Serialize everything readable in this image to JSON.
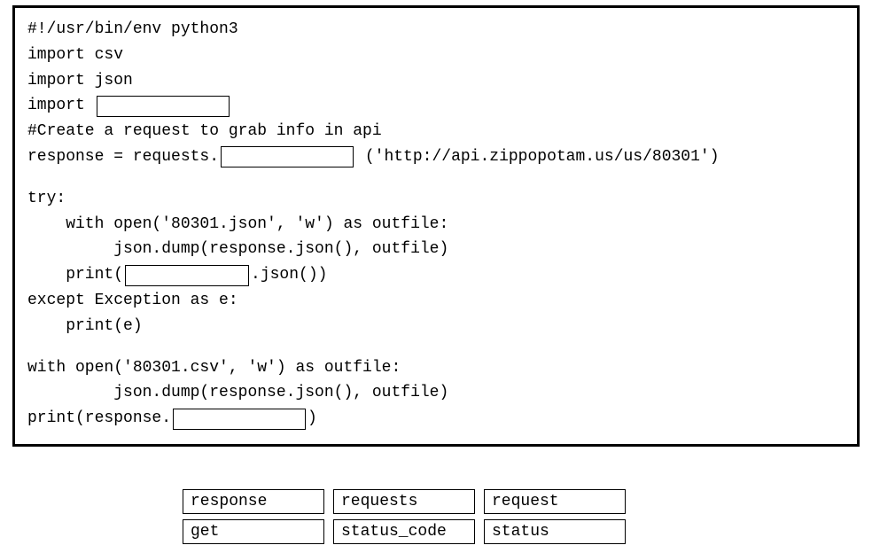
{
  "code": {
    "l1": "#!/usr/bin/env python3",
    "l2": "import csv",
    "l3": "import json",
    "l4a": "import ",
    "l5": "#Create a request to grab info in api",
    "l6a": "response = requests.",
    "l6b": " ('http://api.zippopotam.us/us/80301')",
    "l7": "try:",
    "l8": "    with open('80301.json', 'w') as outfile:",
    "l9": "         json.dump(response.json(), outfile)",
    "l10a": "    print(",
    "l10b": ".json())",
    "l11": "except Exception as e:",
    "l12": "    print(e)",
    "l13": "with open('80301.csv', 'w') as outfile:",
    "l14": "         json.dump(response.json(), outfile)",
    "l15a": "print(response.",
    "l15b": ")"
  },
  "blanks": {
    "b1_width": 150,
    "b2_width": 150,
    "b3_width": 140,
    "b4_width": 150
  },
  "options": {
    "row1": [
      "response",
      "requests",
      "request"
    ],
    "row2": [
      "get",
      "status_code",
      "status"
    ]
  }
}
